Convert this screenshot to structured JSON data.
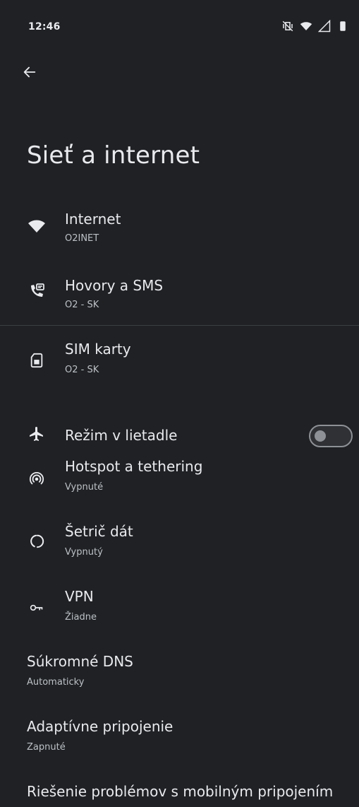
{
  "status_bar": {
    "time": "12:46"
  },
  "header": {
    "title": "Sieť a internet"
  },
  "items": [
    {
      "label": "Internet",
      "sub": "O2INET",
      "icon": "wifi-icon"
    },
    {
      "label": "Hovory a SMS",
      "sub": "O2 - SK",
      "icon": "calls-sms-icon"
    },
    {
      "label": "SIM karty",
      "sub": "O2 - SK",
      "icon": "sim-card-icon"
    },
    {
      "label": "Režim v lietadle",
      "icon": "airplane-icon",
      "toggle_on": false
    },
    {
      "label": "Hotspot a tethering",
      "sub": "Vypnuté",
      "icon": "hotspot-icon"
    },
    {
      "label": "Šetrič dát",
      "sub": "Vypnutý",
      "icon": "data-saver-icon"
    },
    {
      "label": "VPN",
      "sub": "Žiadne",
      "icon": "vpn-key-icon"
    },
    {
      "label": "Súkromné DNS",
      "sub": "Automaticky"
    },
    {
      "label": "Adaptívne pripojenie",
      "sub": "Zapnuté"
    },
    {
      "label": "Riešenie problémov s mobilným pripojením"
    }
  ],
  "colors": {
    "background": "#1f2124",
    "text": "#e8eaed",
    "subtext": "#bdc1c6",
    "divider": "#3c4043"
  }
}
